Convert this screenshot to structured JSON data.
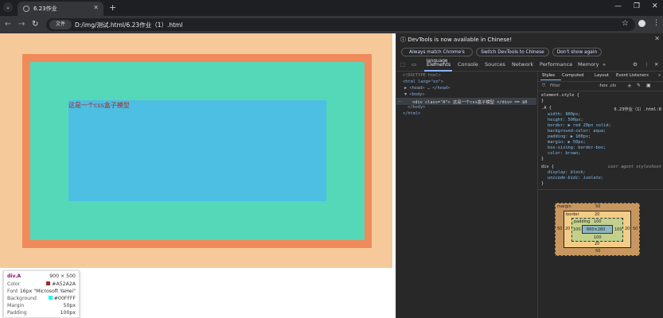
{
  "browser": {
    "tab_title": "6.23作业",
    "url_badge": "文件",
    "url": "D:/img/测试.html/6.23作业（1）.html"
  },
  "page": {
    "label": "这是一个css盒子模型",
    "colors": {
      "page_bg": "#f6c99b",
      "border": "#f08a5a",
      "padding": "#55d8b8",
      "content": "#4dbfe2"
    }
  },
  "tooltip": {
    "selector": "div.A",
    "size": "900 × 500",
    "rows": [
      {
        "label": "Color",
        "value": "#A52A2A"
      },
      {
        "label": "Font",
        "value": "16px \"Microsoft YaHei\""
      },
      {
        "label": "Background",
        "value": "#00FFFF"
      },
      {
        "label": "Margin",
        "value": "50px"
      },
      {
        "label": "Padding",
        "value": "100px"
      }
    ]
  },
  "devtools": {
    "notice": "DevTools is now available in Chinese!",
    "buttons": [
      "Always match Chrome's language",
      "Switch DevTools to Chinese",
      "Don't show again"
    ],
    "tabs": [
      "Elements",
      "Console",
      "Sources",
      "Network",
      "Performance",
      "Memory"
    ],
    "style_tabs": [
      "Styles",
      "Computed",
      "Layout",
      "Event Listeners"
    ],
    "filter_placeholder": "Filter",
    "filter_tools": ":hov .cls",
    "dom": [
      "<!DOCTYPE html>",
      "<html lang=\"en\">",
      "▶ <head> … </head>",
      "▼ <body>",
      "<div class=\"A\"> 这是一个css盒子模型 </div> == $0",
      "</body>",
      "</html>"
    ],
    "rules": {
      "element_style": "element.style {",
      "selector": ".A {",
      "source": "6.23作业（1）.html:8",
      "props": [
        "width: 900px;",
        "height: 500px;",
        "border: ▶ red 20px solid;",
        "background-color: aqua;",
        "padding: ▶ 100px;",
        "margin: ▶ 50px;",
        "box-sizing: border-box;",
        "color: brown;"
      ],
      "ua_selector": "div {",
      "ua_source": "user agent stylesheet",
      "ua_props": [
        "display: block;",
        "unicode-bidi: isolate;"
      ]
    },
    "boxmodel": {
      "margin_label": "margin",
      "margin": "50",
      "border_label": "border",
      "border": "20",
      "padding_label": "padding",
      "padding": "100",
      "content": "660×260"
    }
  }
}
